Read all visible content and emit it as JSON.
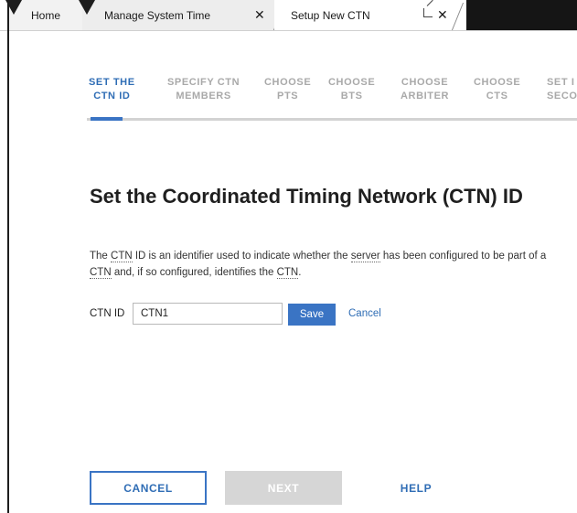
{
  "tabs": {
    "home": "Home",
    "manage": "Manage System Time",
    "setup": "Setup New CTN",
    "close_glyph": "✕"
  },
  "steps": [
    {
      "line1": "SET THE",
      "line2": "CTN ID",
      "active": true
    },
    {
      "line1": "SPECIFY CTN",
      "line2": "MEMBERS",
      "active": false
    },
    {
      "line1": "CHOOSE",
      "line2": "PTS",
      "active": false
    },
    {
      "line1": "CHOOSE",
      "line2": "BTS",
      "active": false
    },
    {
      "line1": "CHOOSE",
      "line2": "ARBITER",
      "active": false
    },
    {
      "line1": "CHOOSE",
      "line2": "CTS",
      "active": false
    },
    {
      "line1": "SET I",
      "line2": "SECO",
      "active": false
    }
  ],
  "main": {
    "title": "Set the Coordinated Timing Network (CTN) ID",
    "desc": {
      "p1": "The ",
      "t1": "CTN",
      "p2": " ID is an identifier used to indicate whether the ",
      "t2": "server",
      "p3": " has been configured to be part of a ",
      "t3": "CTN",
      "p4": " and, if so configured, identifies the ",
      "t4": "CTN",
      "p5": "."
    },
    "field_label": "CTN ID",
    "field_value": "CTN1",
    "save_label": "Save",
    "cancel_label": "Cancel"
  },
  "footer": {
    "cancel": "CANCEL",
    "next": "NEXT",
    "help": "HELP"
  },
  "colors": {
    "accent": "#3a74c4",
    "inactive_step": "#a9a9a9",
    "disabled_button": "#d6d6d6"
  }
}
